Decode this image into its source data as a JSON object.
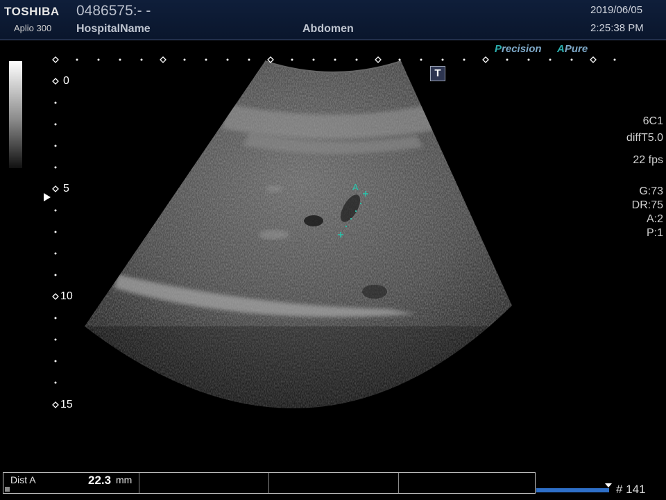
{
  "header": {
    "brand": "TOSHIBA",
    "model": "Aplio 300",
    "patient_id": "0486575:- -",
    "hospital": "HospitalName",
    "exam": "Abdomen",
    "date": "2019/06/05",
    "time": "2:25:38 PM"
  },
  "modes": {
    "precision_prefix": "P",
    "precision_rest": "recision",
    "apure_prefix": "A",
    "apure_rest": "Pure"
  },
  "depth_labels": [
    "0",
    "5",
    "10",
    "15"
  ],
  "text_icon": "T",
  "params": {
    "probe": "6C1",
    "preset": "diffT5.0",
    "fps": "22 fps",
    "gain": "G:73",
    "dr": "DR:75",
    "a": "A:2",
    "p": "P:1"
  },
  "measurement": {
    "label": "Dist A",
    "value": "22.3",
    "unit": "mm",
    "marker": "A"
  },
  "cine": {
    "frame": "# 141"
  },
  "colors": {
    "header_bg": "#0f1e3a",
    "accent_teal": "#2cb0b0",
    "cine_bar": "#2e6fc8",
    "caliper": "#27c9b0"
  }
}
